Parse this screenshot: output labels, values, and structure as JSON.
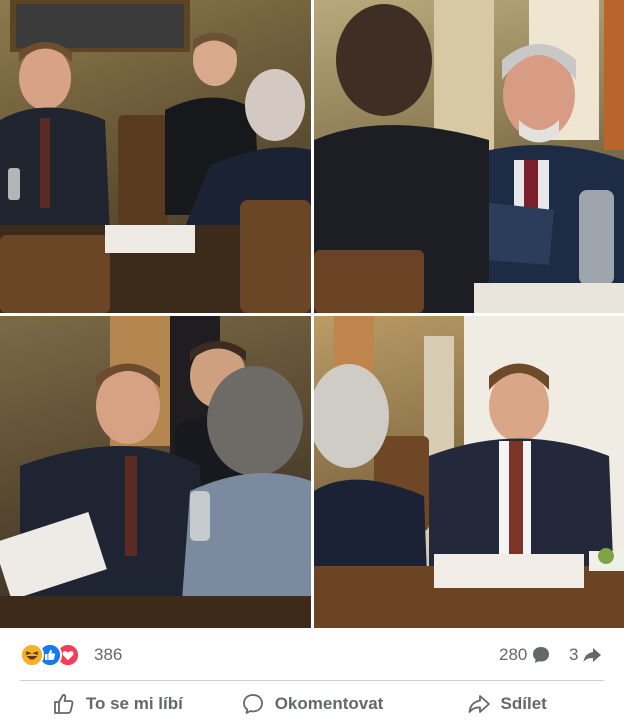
{
  "post": {
    "photos": [
      {
        "alt_icon": "photo"
      },
      {
        "alt_icon": "photo"
      },
      {
        "alt_icon": "photo"
      },
      {
        "alt_icon": "photo"
      }
    ],
    "reactions": {
      "types": [
        "haha-icon",
        "like-icon",
        "love-icon"
      ],
      "count": "386",
      "comments": "280",
      "shares": "3"
    },
    "actions": {
      "like_label": "To se mi líbí",
      "comment_label": "Okomentovat",
      "share_label": "Sdílet"
    },
    "colors": {
      "like_blue": "#1877f2",
      "love_red": "#f33e58",
      "haha_yellow": "#f7b125",
      "secondary_text": "#65676b"
    }
  }
}
